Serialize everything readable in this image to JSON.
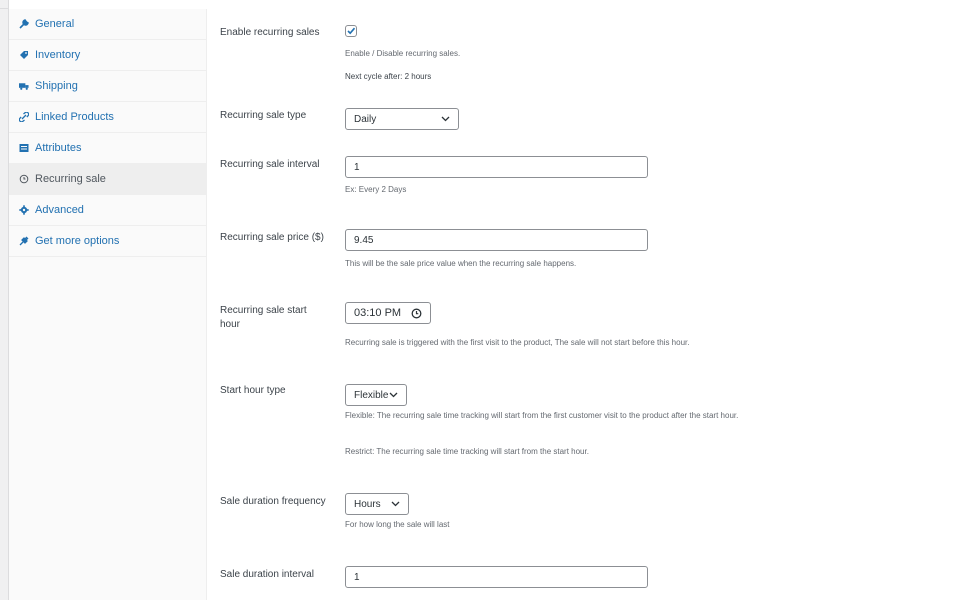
{
  "sidebar": {
    "items": [
      {
        "label": "General",
        "icon": "wrench-icon"
      },
      {
        "label": "Inventory",
        "icon": "tag-icon"
      },
      {
        "label": "Shipping",
        "icon": "truck-icon"
      },
      {
        "label": "Linked Products",
        "icon": "link-icon"
      },
      {
        "label": "Attributes",
        "icon": "table-icon"
      },
      {
        "label": "Recurring sale",
        "icon": "clock-icon",
        "active": true
      },
      {
        "label": "Advanced",
        "icon": "gear-icon"
      },
      {
        "label": "Get more options",
        "icon": "plugin-icon"
      }
    ]
  },
  "form": {
    "enable": {
      "label": "Enable recurring sales",
      "checked": true,
      "desc": "Enable / Disable recurring sales.",
      "note": "Next cycle after: 2 hours"
    },
    "type": {
      "label": "Recurring sale type",
      "value": "Daily"
    },
    "interval": {
      "label": "Recurring sale interval",
      "value": "1",
      "desc": "Ex: Every 2 Days"
    },
    "price": {
      "label": "Recurring sale price ($)",
      "value": "9.45",
      "desc": "This will be the sale price value when the recurring sale happens."
    },
    "start_hour": {
      "label": "Recurring sale start hour",
      "value": "03:10 PM",
      "desc": "Recurring sale is triggered with the first visit to the product, The sale will not start before this hour."
    },
    "start_type": {
      "label": "Start hour type",
      "value": "Flexible",
      "desc_flexible": "Flexible: The recurring sale time tracking will start from the first customer visit to the product after the start hour.",
      "desc_restrict": "Restrict: The recurring sale time tracking will start from the start hour."
    },
    "duration_freq": {
      "label": "Sale duration frequency",
      "value": "Hours",
      "desc": "For how long the sale will last"
    },
    "duration_interval": {
      "label": "Sale duration interval",
      "value": "1"
    }
  },
  "colors": {
    "link": "#2271b1",
    "border": "#8c8f94"
  }
}
